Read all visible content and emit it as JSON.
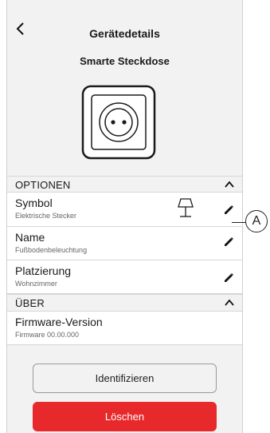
{
  "header": {
    "title": "Gerätedetails"
  },
  "device": {
    "name": "Smarte Steckdose",
    "icon": "socket-icon"
  },
  "sections": {
    "options": {
      "label": "OPTIONEN"
    },
    "about": {
      "label": "ÜBER"
    }
  },
  "rows": {
    "symbol": {
      "title": "Symbol",
      "subtitle": "Elektrische Stecker",
      "icon": "lamp-icon"
    },
    "name": {
      "title": "Name",
      "subtitle": "Fußbodenbeleuchtung"
    },
    "placement": {
      "title": "Platzierung",
      "subtitle": "Wohnzimmer"
    },
    "firmware": {
      "title": "Firmware-Version",
      "subtitle": "Firmware 00.00.000"
    }
  },
  "buttons": {
    "identify": "Identifizieren",
    "delete": "Löschen"
  },
  "callout": {
    "label": "A"
  },
  "colors": {
    "delete": "#e8292b",
    "background": "#f2f2f2"
  }
}
